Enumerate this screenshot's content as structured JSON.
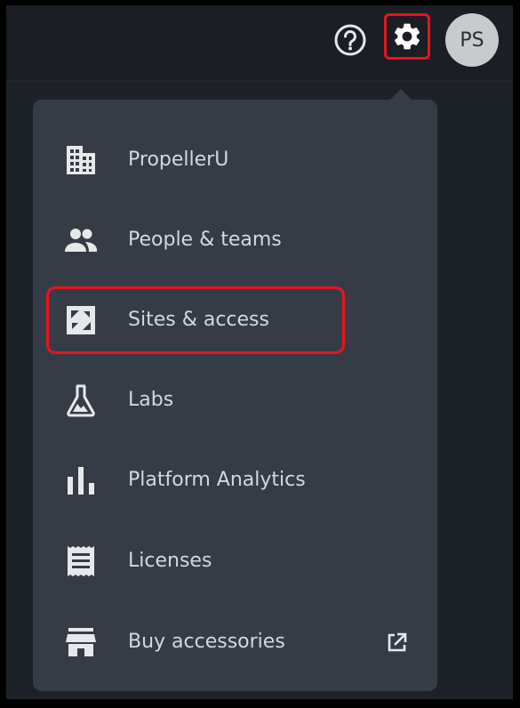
{
  "header": {
    "help_icon": "help-circle-icon",
    "settings_icon": "gear-icon",
    "avatar_initials": "PS"
  },
  "menu": {
    "items": [
      {
        "label": "PropellerU",
        "icon": "building-icon"
      },
      {
        "label": "People & teams",
        "icon": "people-icon"
      },
      {
        "label": "Sites & access",
        "icon": "site-map-icon"
      },
      {
        "label": "Labs",
        "icon": "flask-icon"
      },
      {
        "label": "Platform Analytics",
        "icon": "bar-chart-icon"
      },
      {
        "label": "Licenses",
        "icon": "license-icon"
      },
      {
        "label": "Buy accessories",
        "icon": "store-icon",
        "external_icon": "external-link-icon"
      }
    ]
  },
  "colors": {
    "background": "#1d2128",
    "menu_background": "#363c46",
    "text": "#d4d7dc",
    "icon": "#e6e8eb",
    "highlight": "#e8141c",
    "avatar": "#c9cacc"
  }
}
